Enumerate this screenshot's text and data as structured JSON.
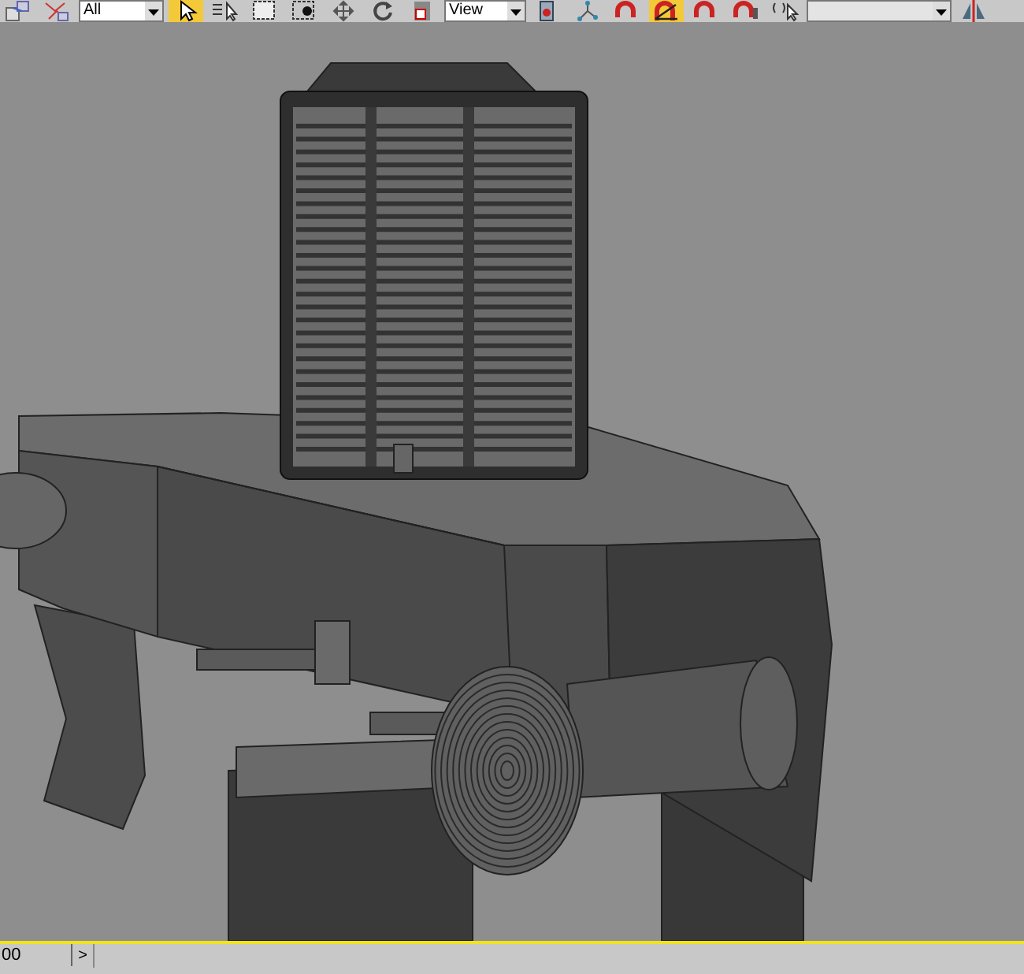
{
  "toolbar": {
    "tools": [
      {
        "kind": "link",
        "selected": false
      },
      {
        "kind": "bind",
        "selected": false
      },
      {
        "kind": "filter",
        "value": "All"
      },
      {
        "kind": "select",
        "selected": true
      },
      {
        "kind": "select-name",
        "selected": false
      },
      {
        "kind": "region",
        "selected": false
      },
      {
        "kind": "crossing",
        "selected": false
      },
      {
        "kind": "move",
        "selected": false
      },
      {
        "kind": "rotate",
        "selected": false
      },
      {
        "kind": "scale",
        "selected": false
      },
      {
        "kind": "coord",
        "value": "View"
      },
      {
        "kind": "pivot",
        "selected": false
      },
      {
        "kind": "manipulate",
        "selected": false
      },
      {
        "kind": "snap",
        "selected": false
      },
      {
        "kind": "angle-snap",
        "selected": true
      },
      {
        "kind": "percent-snap",
        "selected": false
      },
      {
        "kind": "spinner-snap",
        "selected": false
      },
      {
        "kind": "named-sel",
        "selected": false
      },
      {
        "kind": "named-field"
      },
      {
        "kind": "mirror",
        "selected": false
      }
    ]
  },
  "status_bar": {
    "frame": "00",
    "next_label": ">"
  }
}
